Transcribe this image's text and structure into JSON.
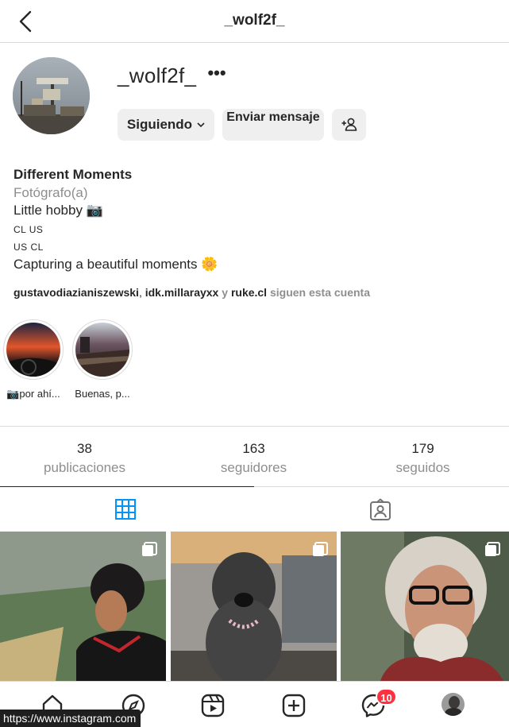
{
  "header": {
    "title": "_wolf2f_",
    "back_icon": "chevron-left-icon"
  },
  "profile": {
    "username": "_wolf2f_",
    "more_label": "•••",
    "follow_button": "Siguiendo",
    "message_button": "Enviar mensaje",
    "add_user_icon": "add-user-icon"
  },
  "bio": {
    "name": "Different Moments",
    "category": "Fotógrafo(a)",
    "line1": "Little hobby 📷",
    "line2": "CL US",
    "line3": "US CL",
    "line4": "Capturing a beautiful moments 🌼"
  },
  "followed_by": {
    "user1": "gustavodiazianiszewski",
    "sep1": ", ",
    "user2": "idk.millarayxx",
    "sep2": " y ",
    "user3": "ruke.cl",
    "suffix": " siguen esta cuenta"
  },
  "highlights": [
    {
      "label": "📷por ahí..."
    },
    {
      "label": "Buenas, p..."
    }
  ],
  "stats": [
    {
      "value": "38",
      "label": "publicaciones"
    },
    {
      "value": "163",
      "label": "seguidores"
    },
    {
      "value": "179",
      "label": "seguidos"
    }
  ],
  "tabs": [
    {
      "icon": "grid-icon",
      "active": true
    },
    {
      "icon": "tagged-icon",
      "active": false
    }
  ],
  "nav": {
    "items": [
      "home-icon",
      "explore-icon",
      "reels-icon",
      "new-post-icon",
      "messenger-icon",
      "profile-avatar"
    ],
    "messenger_badge": "10"
  },
  "status_url": "https://www.instagram.com",
  "colors": {
    "accent": "#0095f6",
    "badge": "#ff3040",
    "muted": "#8e8e8e"
  }
}
